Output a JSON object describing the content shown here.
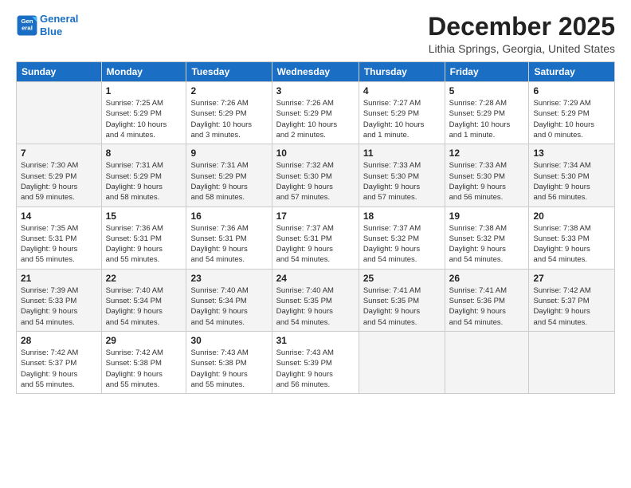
{
  "logo": {
    "line1": "General",
    "line2": "Blue"
  },
  "title": "December 2025",
  "location": "Lithia Springs, Georgia, United States",
  "days_header": [
    "Sunday",
    "Monday",
    "Tuesday",
    "Wednesday",
    "Thursday",
    "Friday",
    "Saturday"
  ],
  "weeks": [
    [
      {
        "day": "",
        "info": ""
      },
      {
        "day": "1",
        "info": "Sunrise: 7:25 AM\nSunset: 5:29 PM\nDaylight: 10 hours\nand 4 minutes."
      },
      {
        "day": "2",
        "info": "Sunrise: 7:26 AM\nSunset: 5:29 PM\nDaylight: 10 hours\nand 3 minutes."
      },
      {
        "day": "3",
        "info": "Sunrise: 7:26 AM\nSunset: 5:29 PM\nDaylight: 10 hours\nand 2 minutes."
      },
      {
        "day": "4",
        "info": "Sunrise: 7:27 AM\nSunset: 5:29 PM\nDaylight: 10 hours\nand 1 minute."
      },
      {
        "day": "5",
        "info": "Sunrise: 7:28 AM\nSunset: 5:29 PM\nDaylight: 10 hours\nand 1 minute."
      },
      {
        "day": "6",
        "info": "Sunrise: 7:29 AM\nSunset: 5:29 PM\nDaylight: 10 hours\nand 0 minutes."
      }
    ],
    [
      {
        "day": "7",
        "info": "Sunrise: 7:30 AM\nSunset: 5:29 PM\nDaylight: 9 hours\nand 59 minutes."
      },
      {
        "day": "8",
        "info": "Sunrise: 7:31 AM\nSunset: 5:29 PM\nDaylight: 9 hours\nand 58 minutes."
      },
      {
        "day": "9",
        "info": "Sunrise: 7:31 AM\nSunset: 5:29 PM\nDaylight: 9 hours\nand 58 minutes."
      },
      {
        "day": "10",
        "info": "Sunrise: 7:32 AM\nSunset: 5:30 PM\nDaylight: 9 hours\nand 57 minutes."
      },
      {
        "day": "11",
        "info": "Sunrise: 7:33 AM\nSunset: 5:30 PM\nDaylight: 9 hours\nand 57 minutes."
      },
      {
        "day": "12",
        "info": "Sunrise: 7:33 AM\nSunset: 5:30 PM\nDaylight: 9 hours\nand 56 minutes."
      },
      {
        "day": "13",
        "info": "Sunrise: 7:34 AM\nSunset: 5:30 PM\nDaylight: 9 hours\nand 56 minutes."
      }
    ],
    [
      {
        "day": "14",
        "info": "Sunrise: 7:35 AM\nSunset: 5:31 PM\nDaylight: 9 hours\nand 55 minutes."
      },
      {
        "day": "15",
        "info": "Sunrise: 7:36 AM\nSunset: 5:31 PM\nDaylight: 9 hours\nand 55 minutes."
      },
      {
        "day": "16",
        "info": "Sunrise: 7:36 AM\nSunset: 5:31 PM\nDaylight: 9 hours\nand 54 minutes."
      },
      {
        "day": "17",
        "info": "Sunrise: 7:37 AM\nSunset: 5:31 PM\nDaylight: 9 hours\nand 54 minutes."
      },
      {
        "day": "18",
        "info": "Sunrise: 7:37 AM\nSunset: 5:32 PM\nDaylight: 9 hours\nand 54 minutes."
      },
      {
        "day": "19",
        "info": "Sunrise: 7:38 AM\nSunset: 5:32 PM\nDaylight: 9 hours\nand 54 minutes."
      },
      {
        "day": "20",
        "info": "Sunrise: 7:38 AM\nSunset: 5:33 PM\nDaylight: 9 hours\nand 54 minutes."
      }
    ],
    [
      {
        "day": "21",
        "info": "Sunrise: 7:39 AM\nSunset: 5:33 PM\nDaylight: 9 hours\nand 54 minutes."
      },
      {
        "day": "22",
        "info": "Sunrise: 7:40 AM\nSunset: 5:34 PM\nDaylight: 9 hours\nand 54 minutes."
      },
      {
        "day": "23",
        "info": "Sunrise: 7:40 AM\nSunset: 5:34 PM\nDaylight: 9 hours\nand 54 minutes."
      },
      {
        "day": "24",
        "info": "Sunrise: 7:40 AM\nSunset: 5:35 PM\nDaylight: 9 hours\nand 54 minutes."
      },
      {
        "day": "25",
        "info": "Sunrise: 7:41 AM\nSunset: 5:35 PM\nDaylight: 9 hours\nand 54 minutes."
      },
      {
        "day": "26",
        "info": "Sunrise: 7:41 AM\nSunset: 5:36 PM\nDaylight: 9 hours\nand 54 minutes."
      },
      {
        "day": "27",
        "info": "Sunrise: 7:42 AM\nSunset: 5:37 PM\nDaylight: 9 hours\nand 54 minutes."
      }
    ],
    [
      {
        "day": "28",
        "info": "Sunrise: 7:42 AM\nSunset: 5:37 PM\nDaylight: 9 hours\nand 55 minutes."
      },
      {
        "day": "29",
        "info": "Sunrise: 7:42 AM\nSunset: 5:38 PM\nDaylight: 9 hours\nand 55 minutes."
      },
      {
        "day": "30",
        "info": "Sunrise: 7:43 AM\nSunset: 5:38 PM\nDaylight: 9 hours\nand 55 minutes."
      },
      {
        "day": "31",
        "info": "Sunrise: 7:43 AM\nSunset: 5:39 PM\nDaylight: 9 hours\nand 56 minutes."
      },
      {
        "day": "",
        "info": ""
      },
      {
        "day": "",
        "info": ""
      },
      {
        "day": "",
        "info": ""
      }
    ]
  ]
}
